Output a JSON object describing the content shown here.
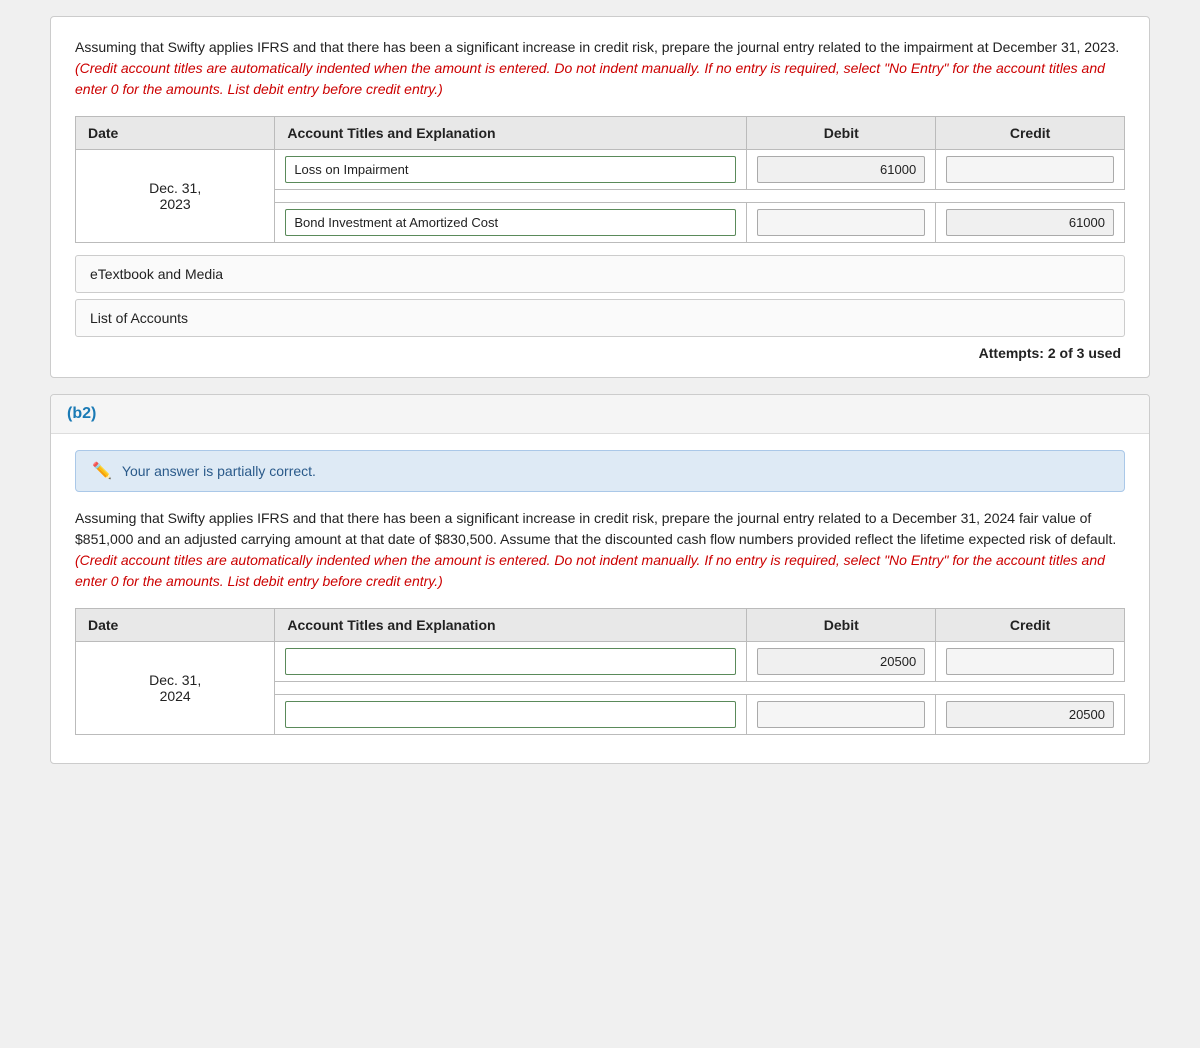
{
  "section_b1": {
    "instruction_plain": "Assuming that Swifty applies IFRS and that there has been a significant increase in credit risk, prepare the journal entry related to the impairment at December 31, 2023. ",
    "instruction_italic": "(Credit account titles are automatically indented when the amount is entered. Do not indent manually. If no entry is required, select \"No Entry\" for the account titles and enter 0 for the amounts. List debit entry before credit entry.)",
    "table": {
      "headers": [
        "Date",
        "Account Titles and Explanation",
        "Debit",
        "Credit"
      ],
      "rows": [
        {
          "date": "Dec. 31,\n2023",
          "account1": "Loss on Impairment",
          "debit1": "61000",
          "credit1": "",
          "account2": "Bond Investment at Amortized Cost",
          "debit2": "",
          "credit2": "61000"
        }
      ]
    },
    "etextbook_label": "eTextbook and Media",
    "list_of_accounts_label": "List of Accounts",
    "attempts_label": "Attempts: 2 of 3 used"
  },
  "section_b2": {
    "label": "(b2)",
    "partial_correct_message": "Your answer is partially correct.",
    "instruction_plain": "Assuming that Swifty applies IFRS and that there has been a significant increase in credit risk, prepare the journal entry related to a December 31, 2024 fair value of $851,000 and an adjusted carrying amount at that date of $830,500. Assume that the discounted cash flow numbers provided reflect the lifetime expected risk of default. ",
    "instruction_italic": "(Credit account titles are automatically indented when the amount is entered. Do not indent manually. If no entry is required, select \"No Entry\" for the account titles and enter 0 for the amounts. List debit entry before credit entry.)",
    "table": {
      "headers": [
        "Date",
        "Account Titles and Explanation",
        "Debit",
        "Credit"
      ],
      "rows": [
        {
          "date": "Dec. 31,\n2024",
          "account1": "",
          "debit1": "20500",
          "credit1": "",
          "account2": "",
          "debit2": "",
          "credit2": "20500"
        }
      ]
    }
  }
}
